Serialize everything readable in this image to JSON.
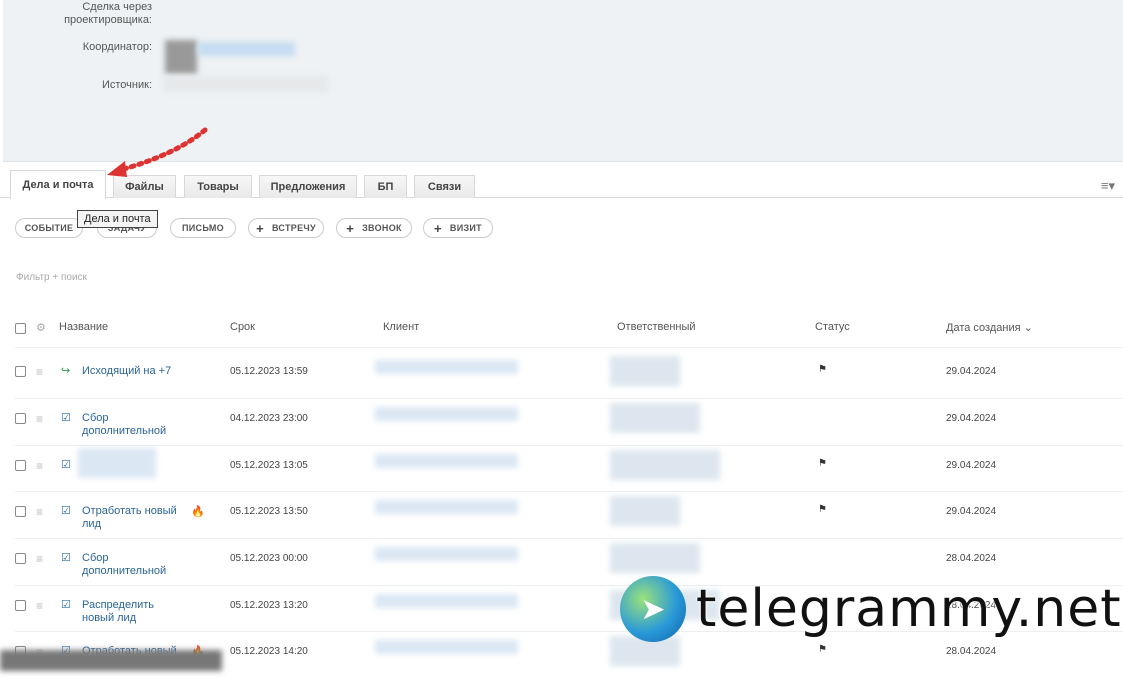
{
  "fields": [
    {
      "label": "Сделка через проектировщика:"
    },
    {
      "label": "Координатор:"
    },
    {
      "label": "Источник:"
    }
  ],
  "tabs": [
    "Дела и почта",
    "Файлы",
    "Товары",
    "Предложения",
    "БП",
    "Связи"
  ],
  "tooltip": "Дела и почта",
  "actions": {
    "event": "СОБЫТИЕ",
    "task": "ЗАДАЧУ",
    "letter": "ПИСЬМО",
    "meeting": "ВСТРЕЧУ",
    "call": "ЗВОНОК",
    "visit": "ВИЗИТ"
  },
  "filter_placeholder": "Фильтр + поиск",
  "columns": {
    "name": "Название",
    "deadline": "Срок",
    "client": "Клиент",
    "responsible": "Ответственный",
    "status": "Статус",
    "created": "Дата создания"
  },
  "rows": [
    {
      "name": "Исходящий на +7",
      "deadline": "05.12.2023 13:59",
      "created": "29.04.2024",
      "type": "call",
      "flag": true,
      "hot": false
    },
    {
      "name": "Сбор дополнительной",
      "deadline": "04.12.2023 23:00",
      "created": "29.04.2024",
      "type": "task",
      "flag": false,
      "hot": false
    },
    {
      "name": "",
      "deadline": "05.12.2023 13:05",
      "created": "29.04.2024",
      "type": "task",
      "flag": true,
      "hot": false
    },
    {
      "name": "Отработать новый лид",
      "deadline": "05.12.2023 13:50",
      "created": "29.04.2024",
      "type": "task",
      "flag": true,
      "hot": true
    },
    {
      "name": "Сбор дополнительной",
      "deadline": "05.12.2023 00:00",
      "created": "28.04.2024",
      "type": "task",
      "flag": false,
      "hot": false
    },
    {
      "name": "Распределить новый лид",
      "deadline": "05.12.2023 13:20",
      "created": "28.04.2024",
      "type": "task",
      "flag": true,
      "hot": false
    },
    {
      "name": "Отработать новый",
      "deadline": "05.12.2023 14:20",
      "created": "28.04.2024",
      "type": "task",
      "flag": true,
      "hot": true
    }
  ],
  "watermark": "telegrammy.net",
  "accent": "#2a6497"
}
